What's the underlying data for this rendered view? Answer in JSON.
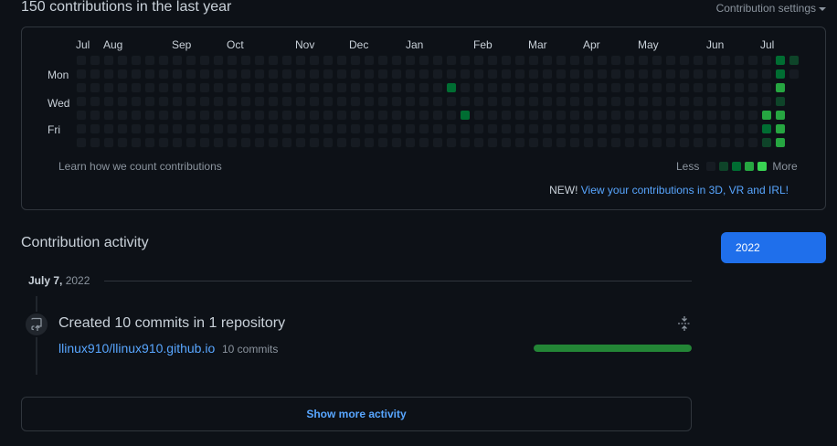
{
  "header": {
    "title": "150 contributions in the last year",
    "settings_label": "Contribution settings"
  },
  "graph": {
    "months": [
      "Jul",
      "Aug",
      "Sep",
      "Oct",
      "Nov",
      "Dec",
      "Jan",
      "Feb",
      "Mar",
      "Apr",
      "May",
      "Jun",
      "Jul"
    ],
    "days": [
      "Mon",
      "Wed",
      "Fri"
    ],
    "weeks": 53,
    "first_week_start_day": 0,
    "last_week_days": 2,
    "colors": [
      "#161b22",
      "#0e4429",
      "#006d32",
      "#26a641",
      "#39d353"
    ],
    "activity": [
      {
        "week": 27,
        "day": 2,
        "level": 2
      },
      {
        "week": 28,
        "day": 4,
        "level": 2
      },
      {
        "week": 50,
        "day": 4,
        "level": 3
      },
      {
        "week": 50,
        "day": 5,
        "level": 2
      },
      {
        "week": 50,
        "day": 6,
        "level": 1
      },
      {
        "week": 51,
        "day": 0,
        "level": 2
      },
      {
        "week": 51,
        "day": 1,
        "level": 2
      },
      {
        "week": 51,
        "day": 2,
        "level": 3
      },
      {
        "week": 51,
        "day": 3,
        "level": 1
      },
      {
        "week": 51,
        "day": 4,
        "level": 3
      },
      {
        "week": 51,
        "day": 5,
        "level": 3
      },
      {
        "week": 51,
        "day": 6,
        "level": 3
      },
      {
        "week": 52,
        "day": 0,
        "level": 1
      }
    ],
    "learn_link": "Learn how we count contributions",
    "legend_less": "Less",
    "legend_more": "More",
    "new_label": "NEW!",
    "new_link": "View your contributions in 3D, VR and IRL!"
  },
  "activity": {
    "title": "Contribution activity",
    "year_button": "2022",
    "date_main": "July 7,",
    "date_year": "2022",
    "icon_name": "repo-push-icon",
    "created_text": "Created 10 commits in 1 repository",
    "repo_name": "llinux910/llinux910.github.io",
    "commit_count": "10 commits",
    "commit_share": 1.0,
    "show_more": "Show more activity"
  }
}
